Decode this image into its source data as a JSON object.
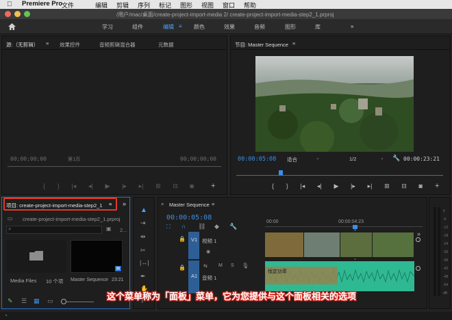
{
  "menubar": {
    "app_name": "Premiere Pro",
    "items": [
      "文件",
      "编辑",
      "剪辑",
      "序列",
      "标记",
      "图形",
      "视图",
      "窗口",
      "帮助"
    ]
  },
  "titlebar": {
    "title": "/用户/mac/桌面/create-project-import-media 2/  create-project-import-media-step2_1.prproj"
  },
  "workspaces": {
    "items": [
      "学习",
      "组件",
      "编辑",
      "颜色",
      "效果",
      "音频",
      "图形",
      "库"
    ],
    "active": "编辑",
    "overflow": "»"
  },
  "source_panel": {
    "tabs": [
      "源:（无剪辑）",
      "效果控件",
      "音频剪辑混合器",
      "元数据"
    ],
    "timecode_left": "00;00;00;00",
    "page_indicator": "第1页",
    "timecode_right": "00;00;00;00"
  },
  "program_panel": {
    "tab": "节目: Master Sequence",
    "timecode_current": "00:00:05:08",
    "fit": "适合",
    "resolution": "1/2",
    "timecode_duration": "00:00:23:21"
  },
  "project_panel": {
    "tab": "项目: create-project-import-media-step2_1",
    "file": "create-project-import-media-step2_1.prproj",
    "count_suffix": "2...",
    "items": [
      {
        "name": "Media Files",
        "info": "10 个项"
      },
      {
        "name": "Master Sequence",
        "info": "23:21"
      }
    ]
  },
  "timeline_panel": {
    "tab": "Master Sequence",
    "timecode": "00:00:05:08",
    "ruler": [
      "00:00",
      "00:00:04:23"
    ],
    "tracks": [
      {
        "id": "V1",
        "name": "视频 1"
      },
      {
        "id": "A1",
        "name": "音频 1"
      }
    ],
    "clip_label": "恒定功率",
    "overflow": "»"
  },
  "audio_meter": {
    "labels": [
      "0",
      "-6",
      "-12",
      "-18",
      "-24",
      "-30",
      "-36",
      "-42",
      "-48",
      "-54",
      "dB"
    ]
  },
  "caption": "这个菜单称为「面板」菜单，它为您提供与这个面板相关的选项",
  "colors": {
    "accent": "#3b8fe8",
    "annotation": "#e03a2a",
    "audio_clip": "#2fb992"
  }
}
